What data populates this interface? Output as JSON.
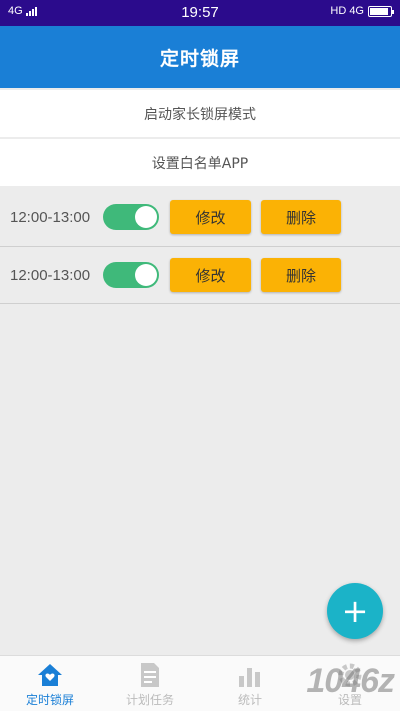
{
  "status_bar": {
    "network": "4G",
    "time": "19:57",
    "hd": "HD",
    "network_right": "4G",
    "battery_level": 0.9
  },
  "header": {
    "title": "定时锁屏"
  },
  "menu": {
    "parent_mode": "启动家长锁屏模式",
    "whitelist": "设置白名单APP"
  },
  "schedules": [
    {
      "time": "12:00-13:00",
      "enabled": true,
      "edit_label": "修改",
      "delete_label": "删除"
    },
    {
      "time": "12:00-13:00",
      "enabled": true,
      "edit_label": "修改",
      "delete_label": "删除"
    }
  ],
  "fab": {
    "icon": "plus-icon",
    "label": "+"
  },
  "bottom_nav": [
    {
      "label": "定时锁屏",
      "icon": "home-icon",
      "active": true
    },
    {
      "label": "计划任务",
      "icon": "document-icon",
      "active": false
    },
    {
      "label": "统计",
      "icon": "bar-chart-icon",
      "active": false
    },
    {
      "label": "设置",
      "icon": "gear-icon",
      "active": false
    }
  ],
  "watermark": "1046z",
  "colors": {
    "status_bar": "#2b0b8c",
    "header": "#1a7fd6",
    "toggle_on": "#3fb97a",
    "button": "#fbb205",
    "fab": "#1bb3c8",
    "nav_active": "#1a7fd6",
    "nav_inactive": "#bbbbbb"
  }
}
